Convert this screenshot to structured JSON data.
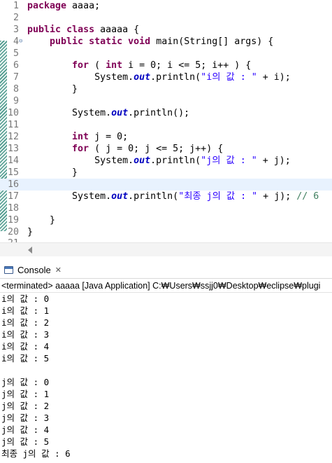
{
  "editor": {
    "lines": [
      {
        "n": "1",
        "segs": [
          [
            "kw",
            "package"
          ],
          [
            "",
            " aaaa;"
          ]
        ]
      },
      {
        "n": "2",
        "segs": []
      },
      {
        "n": "3",
        "segs": [
          [
            "kw",
            "public"
          ],
          [
            "",
            " "
          ],
          [
            "kw",
            "class"
          ],
          [
            "",
            " aaaaa {"
          ]
        ]
      },
      {
        "n": "4",
        "fold": true,
        "segs": [
          [
            "",
            "    "
          ],
          [
            "kw",
            "public"
          ],
          [
            "",
            " "
          ],
          [
            "kw",
            "static"
          ],
          [
            "",
            " "
          ],
          [
            "kw",
            "void"
          ],
          [
            "",
            " main(String[] args) {"
          ]
        ]
      },
      {
        "n": "5",
        "segs": []
      },
      {
        "n": "6",
        "segs": [
          [
            "",
            "        "
          ],
          [
            "kw",
            "for"
          ],
          [
            "",
            " ( "
          ],
          [
            "kw",
            "int"
          ],
          [
            "",
            " i = 0; i <= 5; i++ ) {"
          ]
        ]
      },
      {
        "n": "7",
        "segs": [
          [
            "",
            "            System."
          ],
          [
            "fld",
            "out"
          ],
          [
            "",
            ".println("
          ],
          [
            "str",
            "\"i의 값 : \""
          ],
          [
            "",
            " + i);"
          ]
        ]
      },
      {
        "n": "8",
        "segs": [
          [
            "",
            "        }"
          ]
        ]
      },
      {
        "n": "9",
        "segs": []
      },
      {
        "n": "10",
        "segs": [
          [
            "",
            "        System."
          ],
          [
            "fld",
            "out"
          ],
          [
            "",
            ".println();"
          ]
        ]
      },
      {
        "n": "11",
        "segs": []
      },
      {
        "n": "12",
        "segs": [
          [
            "",
            "        "
          ],
          [
            "kw",
            "int"
          ],
          [
            "",
            " j = 0;"
          ]
        ]
      },
      {
        "n": "13",
        "segs": [
          [
            "",
            "        "
          ],
          [
            "kw",
            "for"
          ],
          [
            "",
            " ( j = 0; j <= 5; j++) {"
          ]
        ]
      },
      {
        "n": "14",
        "segs": [
          [
            "",
            "            System."
          ],
          [
            "fld",
            "out"
          ],
          [
            "",
            ".println("
          ],
          [
            "str",
            "\"j의 값 : \""
          ],
          [
            "",
            " + j);"
          ]
        ]
      },
      {
        "n": "15",
        "segs": [
          [
            "",
            "        }"
          ]
        ]
      },
      {
        "n": "16",
        "current": true,
        "segs": []
      },
      {
        "n": "17",
        "segs": [
          [
            "",
            "        System."
          ],
          [
            "fld",
            "out"
          ],
          [
            "",
            ".println("
          ],
          [
            "str",
            "\"최종 j의 값 : \""
          ],
          [
            "",
            " + j); "
          ],
          [
            "cmt",
            "// 6"
          ]
        ]
      },
      {
        "n": "18",
        "segs": []
      },
      {
        "n": "19",
        "segs": [
          [
            "",
            "    }"
          ]
        ]
      },
      {
        "n": "20",
        "segs": [
          [
            "",
            "}"
          ]
        ]
      }
    ],
    "partial_line_number": "21"
  },
  "console": {
    "tab_label": "Console",
    "close_symbol": "✕",
    "status": "<terminated> aaaaa [Java Application] C:₩Users₩ssjj0₩Desktop₩eclipse₩plugi",
    "output": [
      "i의 값 : 0",
      "i의 값 : 1",
      "i의 값 : 2",
      "i의 값 : 3",
      "i의 값 : 4",
      "i의 값 : 5",
      "",
      "j의 값 : 0",
      "j의 값 : 1",
      "j의 값 : 2",
      "j의 값 : 3",
      "j의 값 : 4",
      "j의 값 : 5",
      "최종 j의 값 : 6"
    ]
  },
  "colors": {
    "keyword": "#7f0055",
    "string": "#2a00ff",
    "field": "#0000c0",
    "comment": "#3f7f5f",
    "current_line": "#e8f2fe"
  },
  "icons": {
    "console": "console-icon",
    "close": "close-icon",
    "fold": "fold-collapse-icon",
    "scroll_left": "scroll-left-arrow-icon"
  }
}
